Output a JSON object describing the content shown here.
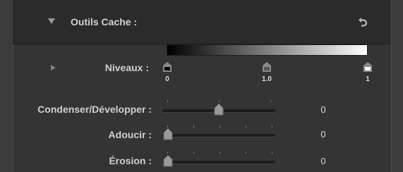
{
  "header": {
    "title": "Outils Cache :",
    "reset_icon": "undo-arrow-icon"
  },
  "levels": {
    "label": "Niveaux :",
    "expand_icon": "disclosure-right-icon",
    "black_point_label": "0",
    "gamma_label": "1.0",
    "white_point_label": "1"
  },
  "sliders": [
    {
      "label": "Condenser/Développer :",
      "value": "0",
      "position": 0.5
    },
    {
      "label": "Adoucir :",
      "value": "0",
      "position": 0.0
    },
    {
      "label": "Érosion :",
      "value": "0",
      "position": 0.0
    }
  ]
}
